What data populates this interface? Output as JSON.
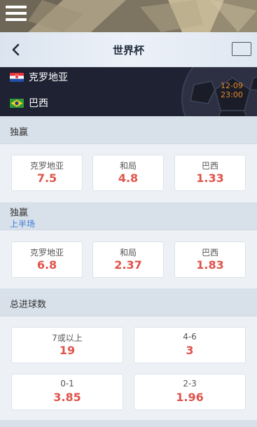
{
  "header": {
    "title": "世界杯"
  },
  "match": {
    "home_team": "克罗地亚",
    "away_team": "巴西",
    "date": "12-09",
    "time": "23:00"
  },
  "markets": [
    {
      "title": "独赢",
      "subtitle": "",
      "options": [
        {
          "label": "克罗地亚",
          "odds": "7.5"
        },
        {
          "label": "和局",
          "odds": "4.8"
        },
        {
          "label": "巴西",
          "odds": "1.33"
        }
      ]
    },
    {
      "title": "独赢",
      "subtitle": "上半场",
      "options": [
        {
          "label": "克罗地亚",
          "odds": "6.8"
        },
        {
          "label": "和局",
          "odds": "2.37"
        },
        {
          "label": "巴西",
          "odds": "1.83"
        }
      ]
    },
    {
      "title": "总进球数",
      "subtitle": "",
      "options": [
        {
          "label": "7或以上",
          "odds": "19"
        },
        {
          "label": "4-6",
          "odds": "3"
        },
        {
          "label": "0-1",
          "odds": "3.85"
        },
        {
          "label": "2-3",
          "odds": "1.96"
        }
      ]
    }
  ],
  "icons": {
    "menu": "hamburger-icon",
    "back": "chevron-left-icon",
    "right": "square-icon",
    "home_flag": "croatia-flag-icon",
    "away_flag": "brazil-flag-icon"
  },
  "colors": {
    "odds": "#e0534a",
    "match_time": "#e58a2a",
    "subtitle_link": "#3b7bd4",
    "match_bg": "#1f2232"
  }
}
